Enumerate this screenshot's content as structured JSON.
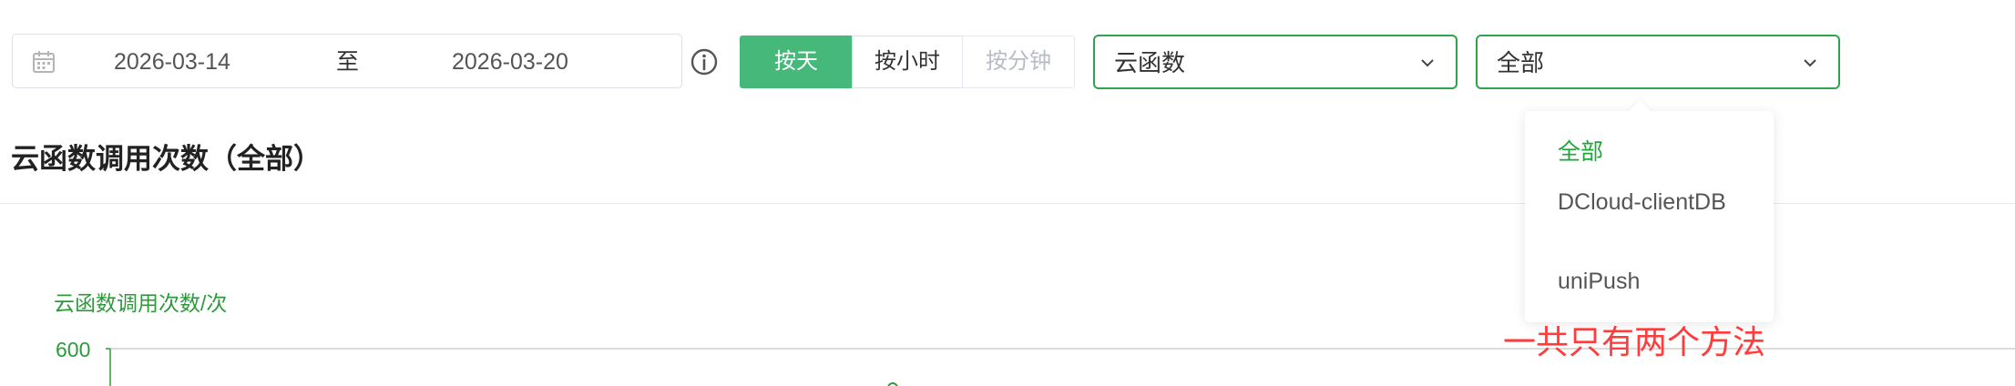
{
  "date_range": {
    "start": "2026-03-14",
    "separator": "至",
    "end": "2026-03-20"
  },
  "granularity": {
    "buttons": [
      {
        "label": "按天",
        "active": true
      },
      {
        "label": "按小时",
        "active": false
      },
      {
        "label": "按分钟",
        "active": false
      }
    ]
  },
  "filters": {
    "type_select": {
      "value": "云函数"
    },
    "method_select": {
      "value": "全部"
    }
  },
  "dropdown": {
    "options": [
      {
        "label": "全部",
        "selected": true
      },
      {
        "label": "DCloud-clientDB",
        "selected": false
      },
      {
        "label": "uniPush",
        "selected": false
      }
    ]
  },
  "section": {
    "title": "云函数调用次数（全部）"
  },
  "chart_data": {
    "type": "line",
    "ylabel": "云函数调用次数/次",
    "yticks": [
      "600"
    ]
  },
  "annotation": {
    "text": "一共只有两个方法"
  },
  "colors": {
    "accent": "#45b87a",
    "select_border": "#2ea44f",
    "chart_green": "#2e9a3c",
    "annotation_red": "#ff3b3b"
  },
  "icons": {
    "date": "calendar-icon",
    "info": "info-icon",
    "chevron": "chevron-down-icon"
  }
}
